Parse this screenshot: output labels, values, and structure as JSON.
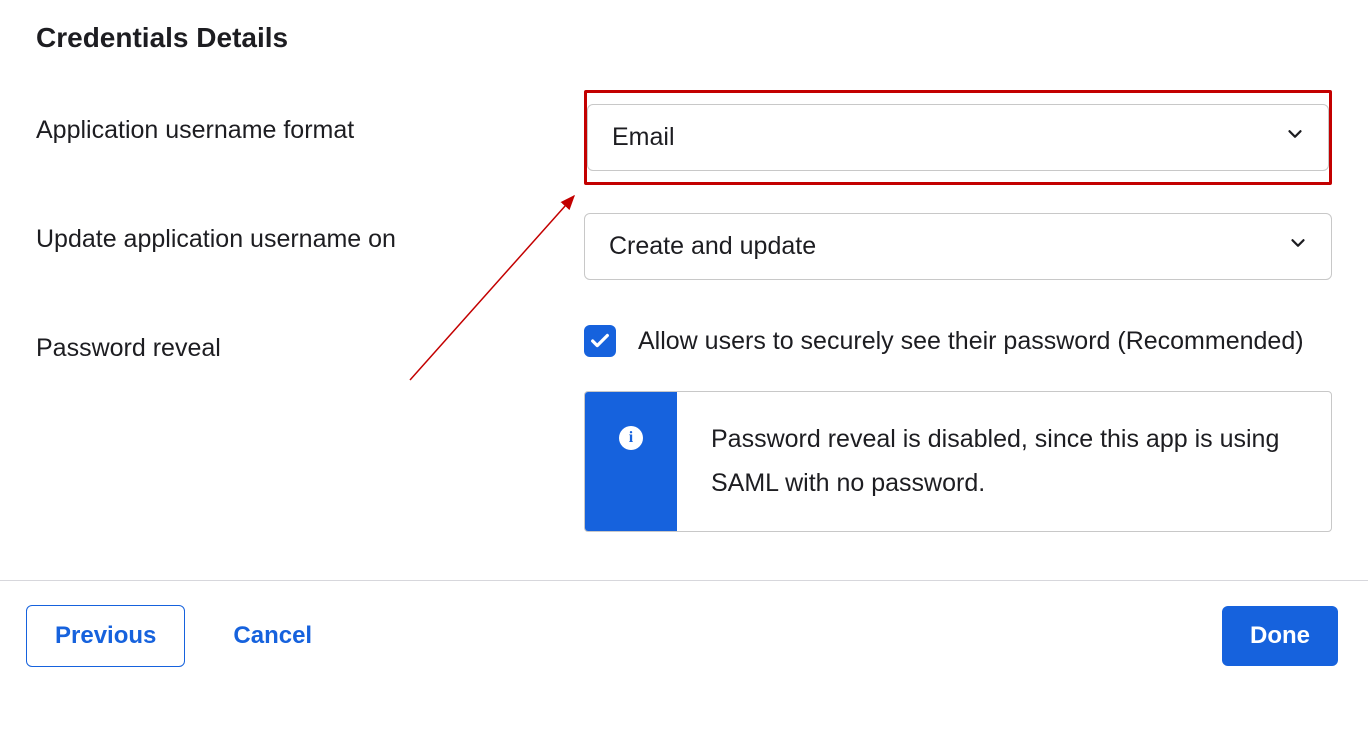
{
  "section": {
    "title": "Credentials Details"
  },
  "fields": {
    "username_format": {
      "label": "Application username format",
      "value": "Email"
    },
    "update_on": {
      "label": "Update application username on",
      "value": "Create and update"
    },
    "password_reveal": {
      "label": "Password reveal",
      "checkbox_label": "Allow users to securely see their password (Recommended)",
      "checked": true,
      "info_text": "Password reveal is disabled, since this app is using SAML with no password."
    }
  },
  "footer": {
    "previous": "Previous",
    "cancel": "Cancel",
    "done": "Done"
  },
  "colors": {
    "primary": "#1662dd",
    "highlight": "#c30000"
  }
}
